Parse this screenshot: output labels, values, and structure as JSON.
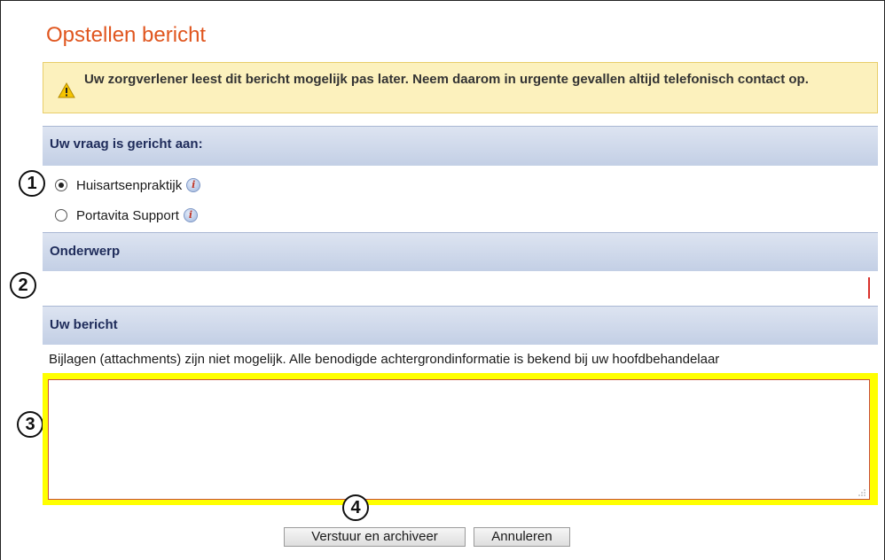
{
  "page": {
    "title": "Opstellen bericht"
  },
  "warning": {
    "text": "Uw zorgverlener leest dit bericht mogelijk pas later. Neem daarom in urgente gevallen altijd telefonisch contact op.",
    "icon": "warning-icon"
  },
  "recipient": {
    "heading": "Uw vraag is gericht aan:",
    "options": [
      {
        "label": "Huisartsenpraktijk",
        "selected": true
      },
      {
        "label": "Portavita Support",
        "selected": false
      }
    ]
  },
  "subject": {
    "heading": "Onderwerp",
    "value": ""
  },
  "message": {
    "heading": "Uw bericht",
    "hint": "Bijlagen (attachments) zijn niet mogelijk. Alle benodigde achtergrondinformatie is bekend bij uw hoofdbehandelaar",
    "value": ""
  },
  "buttons": {
    "send": "Verstuur en archiveer",
    "cancel": "Annuleren"
  },
  "callouts": [
    "1",
    "2",
    "3",
    "4"
  ],
  "colors": {
    "title": "#e0561f",
    "warning_bg": "#fcf1bd",
    "section_bar": "#c3cfe5",
    "highlight": "#ffff00",
    "required_marker": "#d9302b"
  }
}
